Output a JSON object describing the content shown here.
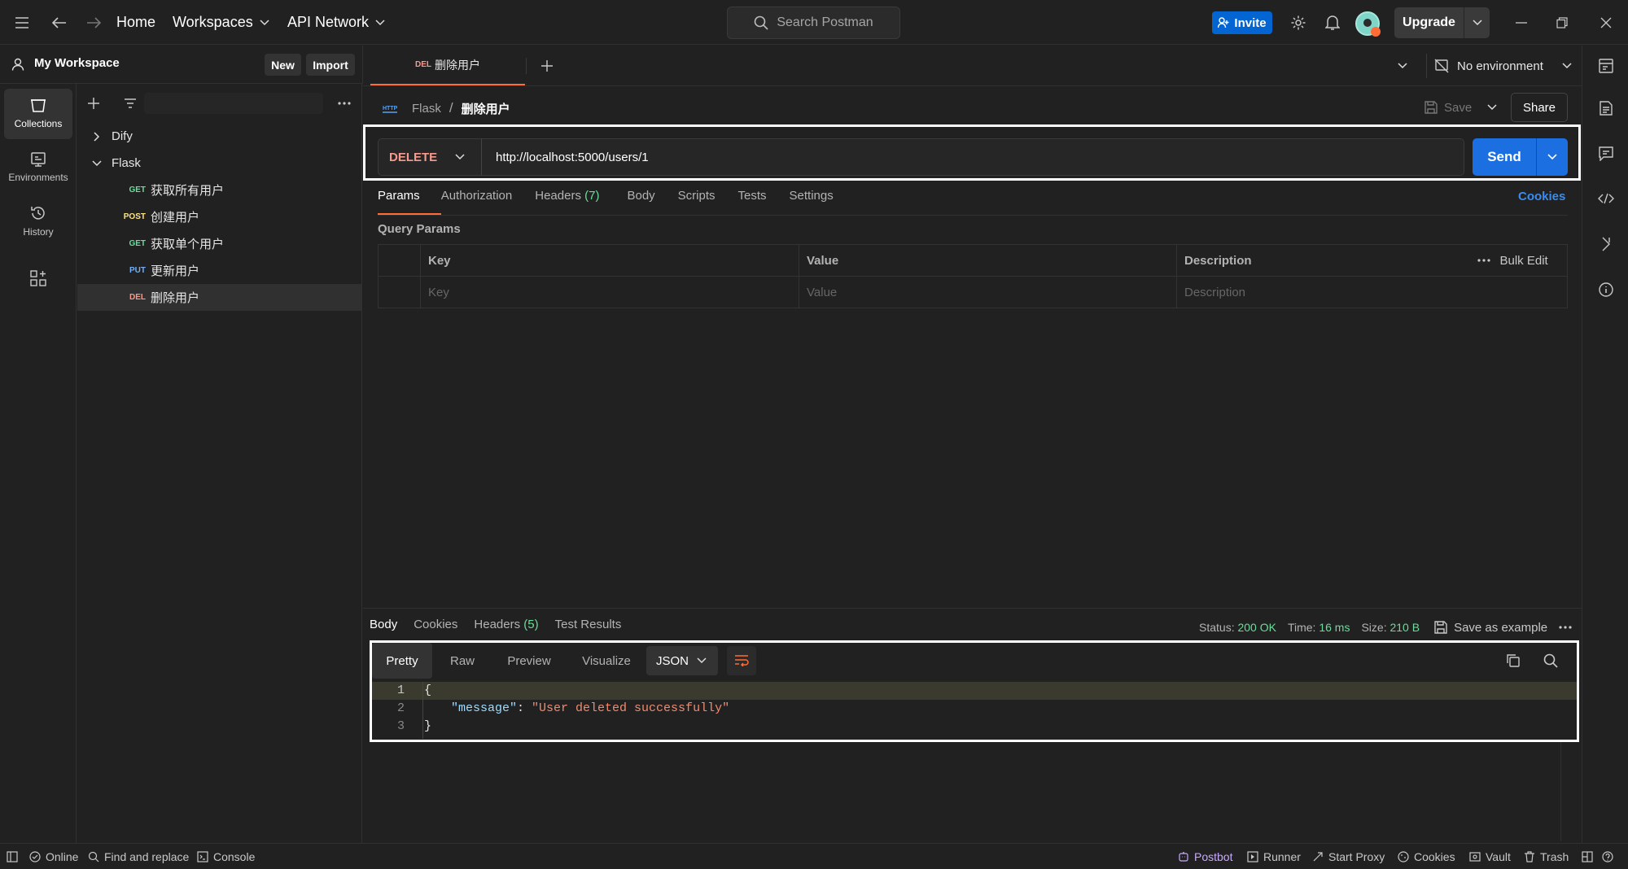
{
  "topbar": {
    "home": "Home",
    "workspaces": "Workspaces",
    "api_network": "API Network",
    "search_placeholder": "Search Postman",
    "invite": "Invite",
    "upgrade": "Upgrade"
  },
  "workspace": {
    "name": "My Workspace",
    "new_label": "New",
    "import_label": "Import"
  },
  "rail": [
    {
      "label": "Collections",
      "icon": "collections-icon"
    },
    {
      "label": "Environments",
      "icon": "environments-icon"
    },
    {
      "label": "History",
      "icon": "history-icon"
    }
  ],
  "tree": {
    "collections": [
      {
        "name": "Dify",
        "expanded": false
      },
      {
        "name": "Flask",
        "expanded": true
      }
    ],
    "requests": [
      {
        "method": "GET",
        "name": "获取所有用户",
        "color": "#6bdd9a"
      },
      {
        "method": "POST",
        "name": "创建用户",
        "color": "#ffe47e"
      },
      {
        "method": "GET",
        "name": "获取单个用户",
        "color": "#6bdd9a"
      },
      {
        "method": "PUT",
        "name": "更新用户",
        "color": "#74aef6"
      },
      {
        "method": "DEL",
        "name": "删除用户",
        "color": "#f79a8e"
      }
    ]
  },
  "tabs": {
    "active": {
      "method": "DEL",
      "name": "删除用户"
    },
    "environment": "No environment"
  },
  "request": {
    "breadcrumb_collection": "Flask",
    "breadcrumb_separator": "/",
    "title": "删除用户",
    "save": "Save",
    "share": "Share",
    "method": "DELETE",
    "url": "http://localhost:5000/users/1",
    "send": "Send",
    "subtabs": [
      "Params",
      "Authorization",
      "Headers",
      "Body",
      "Scripts",
      "Tests",
      "Settings"
    ],
    "headers_count": "(7)",
    "cookies": "Cookies",
    "query_params_title": "Query Params",
    "table": {
      "headers": [
        "Key",
        "Value",
        "Description"
      ],
      "placeholders": [
        "Key",
        "Value",
        "Description"
      ],
      "bulk_edit": "Bulk Edit"
    }
  },
  "response": {
    "tabs": [
      "Body",
      "Cookies",
      "Headers",
      "Test Results"
    ],
    "headers_count": "(5)",
    "status_label": "Status:",
    "status_value": "200 OK",
    "time_label": "Time:",
    "time_value": "16 ms",
    "size_label": "Size:",
    "size_value": "210 B",
    "save_example": "Save as example",
    "views": [
      "Pretty",
      "Raw",
      "Preview",
      "Visualize"
    ],
    "format": "JSON",
    "code": {
      "line_numbers": [
        "1",
        "2",
        "3"
      ],
      "open": "{",
      "key": "\"message\"",
      "colon": ": ",
      "value": "\"User deleted successfully\"",
      "close": "}"
    }
  },
  "statusbar": {
    "online": "Online",
    "find_replace": "Find and replace",
    "console": "Console",
    "postbot": "Postbot",
    "runner": "Runner",
    "start_proxy": "Start Proxy",
    "cookies": "Cookies",
    "vault": "Vault",
    "trash": "Trash"
  },
  "colors": {
    "accent_blue": "#0265d2",
    "send_blue": "#1b6fe0",
    "delete_red": "#f79a8e",
    "success_green": "#6bdd9a",
    "orange": "#ff6c37"
  }
}
